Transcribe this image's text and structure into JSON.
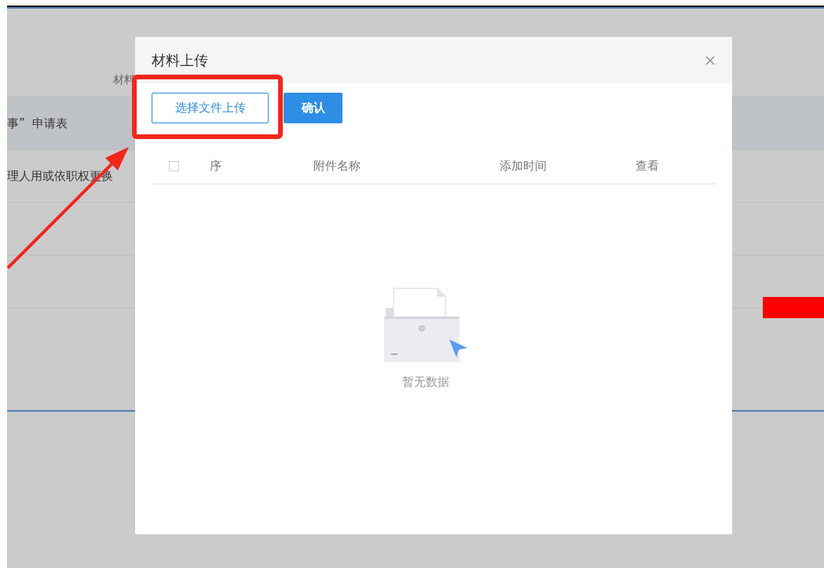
{
  "background": {
    "label": "材料",
    "rows": [
      {
        "text": "事”  申请表",
        "selected": true
      },
      {
        "text": "理人用或依职权更换",
        "selected": false
      }
    ]
  },
  "dialog": {
    "title": "材料上传",
    "buttons": [
      {
        "label": "选择文件上传",
        "kind": "outline"
      },
      {
        "label": "确认",
        "kind": "primary"
      }
    ],
    "table": {
      "select_all": {
        "checked": false
      },
      "columns": [
        "序",
        "附件名称",
        "添加时间",
        "查看"
      ],
      "empty_text": "暂无数据"
    }
  }
}
